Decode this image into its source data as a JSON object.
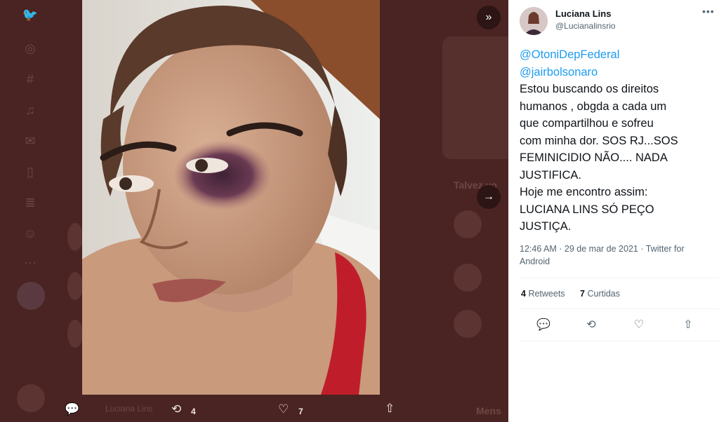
{
  "tweet": {
    "author_name": "Luciana Lins",
    "author_handle": "@Lucianalinsrio",
    "mention_1": "@OtoniDepFederal",
    "mention_2": "@jairbolsonaro",
    "lines": [
      "Estou buscando os direitos",
      "humanos , obgda a cada um",
      "que compartilhou e sofreu",
      "com minha dor. SOS RJ...SOS",
      "FEMINICIDIO NÃO.... NADA",
      "JUSTIFICA.",
      "Hoje me encontro assim:",
      "LUCIANA LINS  SÓ PEÇO",
      "JUSTIÇA."
    ],
    "meta_line_1": "12:46 AM · 29 de mar de 2021 · Twitter for",
    "meta_line_2": "Android",
    "retweets_count": "4",
    "retweets_label": "Retweets",
    "likes_count": "7",
    "likes_label": "Curtidas"
  },
  "media_bar": {
    "retweet_count": "4",
    "like_count": "7"
  },
  "background": {
    "author_faded": "Luciana Lins",
    "sidebar_heading_faded": "Talvez vo",
    "messages_faded": "Mens"
  },
  "icons": {
    "collapse": "double-chevron-right-icon",
    "next": "arrow-right-icon",
    "reply": "reply-icon",
    "retweet": "retweet-icon",
    "like": "heart-icon",
    "share": "share-icon",
    "more": "more-icon"
  },
  "colors": {
    "accent": "#1d9bf0",
    "text": "#0f1419",
    "muted": "#536471"
  }
}
